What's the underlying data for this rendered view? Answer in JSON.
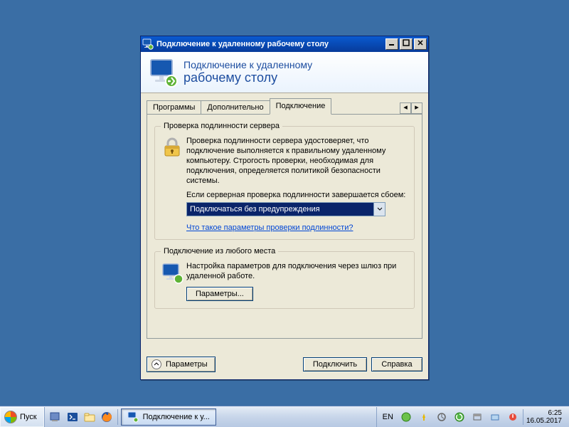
{
  "window": {
    "title": "Подключение к удаленному рабочему столу"
  },
  "banner": {
    "line1": "Подключение к удаленному",
    "line2": "рабочему столу"
  },
  "tabs": {
    "t1": "Программы",
    "t2": "Дополнительно",
    "t3": "Подключение"
  },
  "auth": {
    "legend": "Проверка подлинности сервера",
    "desc": "Проверка подлинности сервера удостоверяет, что подключение выполняется к правильному удаленному компьютеру. Строгость проверки, необходимая для подключения, определяется политикой безопасности системы.",
    "desc2": "Если серверная проверка подлинности завершается сбоем:",
    "selected": "Подключаться без предупреждения",
    "link": "Что такое параметры проверки подлинности?"
  },
  "gateway": {
    "legend": "Подключение из любого места",
    "desc": "Настройка параметров для подключения через шлюз при удаленной работе.",
    "button": "Параметры..."
  },
  "footer": {
    "options": "Параметры",
    "connect": "Подключить",
    "help": "Справка"
  },
  "taskbar": {
    "start": "Пуск",
    "task": "Подключение к у...",
    "lang": "EN",
    "time": "6:25",
    "date": "16.05.2017"
  }
}
